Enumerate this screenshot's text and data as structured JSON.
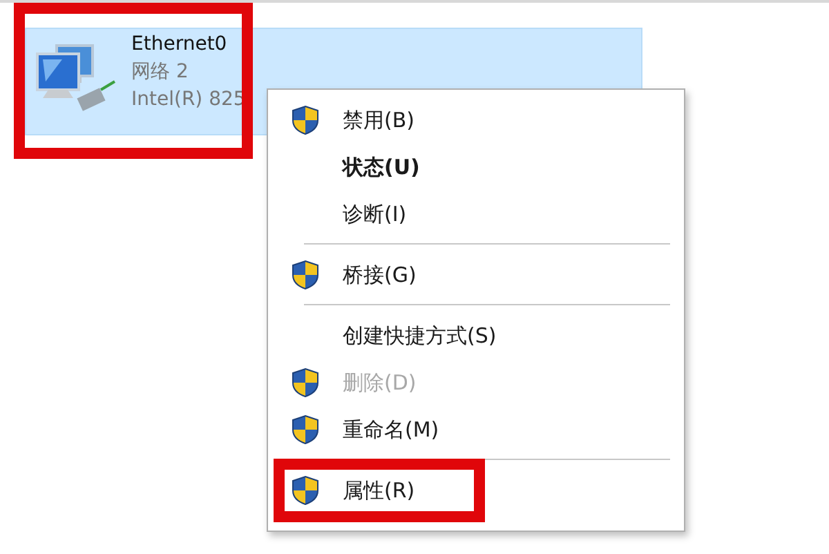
{
  "adapter": {
    "name": "Ethernet0",
    "network": "网络 2",
    "device": "Intel(R) 825",
    "selected": true,
    "highlighted": true
  },
  "context_menu": {
    "items": [
      {
        "kind": "item",
        "label": "禁用(B)",
        "shield": true,
        "bold": false,
        "disabled": false,
        "highlighted": false
      },
      {
        "kind": "item",
        "label": "状态(U)",
        "shield": false,
        "bold": true,
        "disabled": false,
        "highlighted": false
      },
      {
        "kind": "item",
        "label": "诊断(I)",
        "shield": false,
        "bold": false,
        "disabled": false,
        "highlighted": false
      },
      {
        "kind": "separator"
      },
      {
        "kind": "item",
        "label": "桥接(G)",
        "shield": true,
        "bold": false,
        "disabled": false,
        "highlighted": false
      },
      {
        "kind": "separator"
      },
      {
        "kind": "item",
        "label": "创建快捷方式(S)",
        "shield": false,
        "bold": false,
        "disabled": false,
        "highlighted": false
      },
      {
        "kind": "item",
        "label": "删除(D)",
        "shield": true,
        "bold": false,
        "disabled": true,
        "highlighted": false
      },
      {
        "kind": "item",
        "label": "重命名(M)",
        "shield": true,
        "bold": false,
        "disabled": false,
        "highlighted": false
      },
      {
        "kind": "separator"
      },
      {
        "kind": "item",
        "label": "属性(R)",
        "shield": true,
        "bold": false,
        "disabled": false,
        "highlighted": true
      }
    ]
  }
}
